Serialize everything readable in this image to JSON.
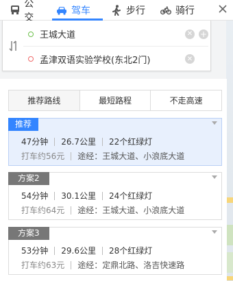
{
  "modes": [
    {
      "label": "公交",
      "icon": "bus-icon",
      "active": false
    },
    {
      "label": "驾车",
      "icon": "car-icon",
      "active": true
    },
    {
      "label": "步行",
      "icon": "walk-icon",
      "active": false
    },
    {
      "label": "骑行",
      "icon": "bike-icon",
      "active": false
    }
  ],
  "search": {
    "start": "王城大道",
    "end": "孟津双语实验学校(东北2门)"
  },
  "preference_tabs": [
    "推荐路线",
    "最短路程",
    "不走高速"
  ],
  "routes": [
    {
      "tag": "推荐",
      "time": "47分钟",
      "distance": "26.7公里",
      "lights": "22个红绿灯",
      "taxi": "打车约56元",
      "via": "途经：王城大道、小浪底大道"
    },
    {
      "tag": "方案2",
      "time": "54分钟",
      "distance": "30.1公里",
      "lights": "24个红绿灯",
      "taxi": "打车约64元",
      "via": "途经：王城大道、小浪底大道"
    },
    {
      "tag": "方案3",
      "time": "53分钟",
      "distance": "29.6公里",
      "lights": "28个红绿灯",
      "taxi": "打车约63元",
      "via": "途经：定鼎北路、洛吉快速路"
    }
  ],
  "colors": {
    "accent": "#3385ff",
    "start_dot": "#6cc04a",
    "end_dot": "#f06b6b"
  }
}
